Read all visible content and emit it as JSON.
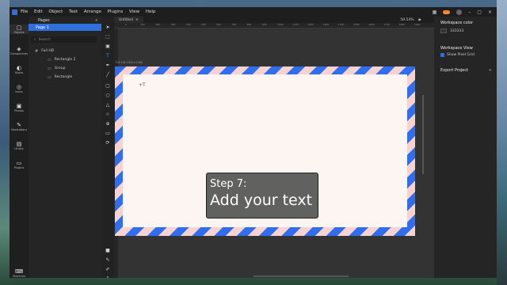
{
  "menu": [
    "File",
    "Edit",
    "Object",
    "Text",
    "Arrange",
    "Plugins",
    "View",
    "Help"
  ],
  "sidebar": [
    {
      "label": "Objects",
      "icon": "objects-icon",
      "glyph": "▢"
    },
    {
      "label": "Components",
      "icon": "components-icon",
      "glyph": "◈"
    },
    {
      "label": "Styles",
      "icon": "styles-icon",
      "glyph": "◐"
    },
    {
      "label": "Icons",
      "icon": "icons-icon",
      "glyph": "◎"
    },
    {
      "label": "Photos",
      "icon": "photos-icon",
      "glyph": "▣"
    },
    {
      "label": "Illustrations",
      "icon": "illustrations-icon",
      "glyph": "✎"
    },
    {
      "label": "UI Kits",
      "icon": "ui-kits-icon",
      "glyph": "▤"
    },
    {
      "label": "Plugins",
      "icon": "plugins-icon",
      "glyph": "▭"
    },
    {
      "label": "Shortcuts",
      "icon": "shortcuts-icon",
      "glyph": "⌨"
    }
  ],
  "pages": {
    "title": "Pages",
    "add": "+",
    "current": "Page 1"
  },
  "search_placeholder": "Search",
  "layers": [
    "Full HD",
    "Rectangle 2",
    "Group",
    "Rectangle"
  ],
  "tab": {
    "label": "Untitled",
    "close": "×"
  },
  "zoom": "59.54%",
  "play": "▶",
  "ruler_ticks": [
    "0",
    "100",
    "200",
    "300",
    "400",
    "500",
    "600",
    "700",
    "800",
    "900",
    "1000",
    "1100",
    "1200",
    "1300",
    "1400",
    "1500",
    "1600",
    "1700",
    "1800",
    "1900"
  ],
  "frame_label": "Full HD 1920×1080",
  "cursor": "+T",
  "tutorial": {
    "line1": "Step 7:",
    "line2": "Add your text"
  },
  "properties": {
    "workspace_color_title": "Workspace color",
    "workspace_color_value": "333333",
    "workspace_view_title": "Workspace View",
    "show_pixel_grid": "Show Pixel Grid",
    "export_title": "Export Project",
    "export_add": "+"
  },
  "colors": {
    "accent": "#2f6fde",
    "stripe_blue": "#2f6ef0",
    "stripe_pink": "#f7d2ce",
    "frame_fill": "#fdf5f2"
  }
}
